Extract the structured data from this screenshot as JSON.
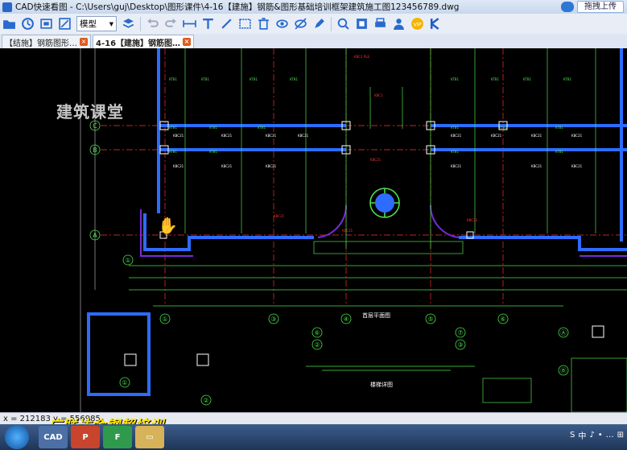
{
  "window": {
    "title": "CAD快速看图 - C:\\Users\\guj\\Desktop\\图形课件\\4-16【建施】钢筋&图形基础培训框架建筑施工图123456789.dwg",
    "upload_label": "拖拽上传"
  },
  "toolbar": {
    "mode_value": "模型",
    "icons": [
      "open-file",
      "history",
      "fullscreen",
      "zoom-window",
      "mode-select",
      "layers",
      "undo",
      "redo",
      "dimension",
      "text",
      "draw-line",
      "cloud-mark",
      "delete",
      "hide-layer",
      "show-layer",
      "edit",
      "search",
      "zoom-extents",
      "print",
      "user",
      "vip",
      "k-logo"
    ]
  },
  "tabs": [
    {
      "label": "【结施】钢筋图形…",
      "active": false
    },
    {
      "label": "4-16【建施】钢筋图…",
      "active": true
    }
  ],
  "watermark": "建筑课堂",
  "drawing": {
    "axis_rows": [
      "C",
      "B",
      "A"
    ],
    "axis_cols_bottom": [
      "①",
      "②",
      "③",
      "④",
      "⑤",
      "⑥"
    ],
    "title": "首层平面图",
    "detail_labels": [
      "⑥",
      "⑦",
      "②",
      "③",
      "⑦",
      "⑦",
      "①",
      "②",
      "Ⓐ",
      "Ⓑ",
      "Ⓐ"
    ],
    "sub_title": "楼梯详图"
  },
  "status": {
    "coords": "x = 212183  y = 556985"
  },
  "brand_overlay": "广联达金钢超培训",
  "taskbar": {
    "apps": [
      "CAD",
      "P",
      "F"
    ]
  },
  "tray": [
    "S",
    "中",
    "♪",
    "•",
    "…",
    "⊞"
  ]
}
